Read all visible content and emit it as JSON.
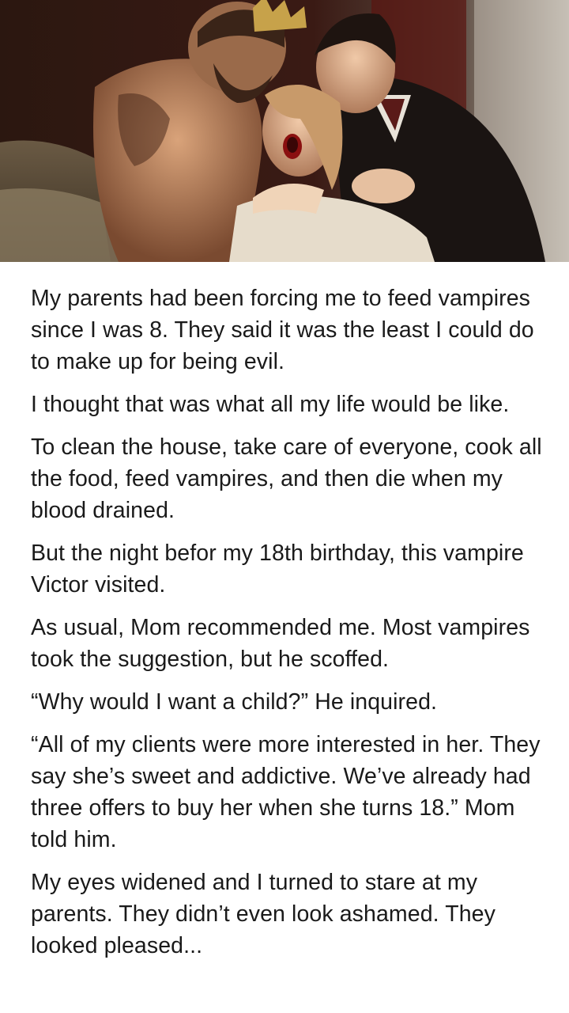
{
  "hero_image": {
    "subject": "bearded crowned man and caped vampire holding a screaming woman"
  },
  "story": {
    "paragraphs": [
      "My parents had been forcing me to feed vampires since I was 8. They said it was the least I could do to make up for being evil.",
      "I thought that was what all my life would be like.",
      "To clean the house, take care of everyone, cook all the food, feed vampires, and then die when my blood drained.",
      "But the night befor my 18th birthday, this vampire Victor visited.",
      "As usual, Mom recommended me. Most vampires took the suggestion, but he scoffed.",
      "“Why would I want a child?” He inquired.",
      "“All of my clients were more interested in her. They say she’s sweet and addictive. We’ve already had three offers to buy her when she turns 18.” Mom told him.",
      "My eyes widened and I turned to stare at my parents. They didn’t even look ashamed. They looked pleased..."
    ]
  }
}
